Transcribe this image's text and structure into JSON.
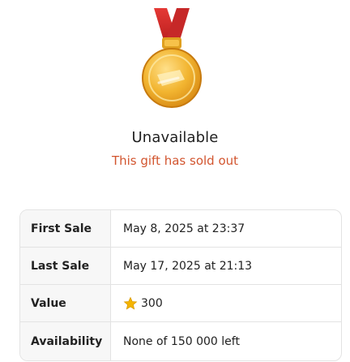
{
  "header": {
    "title": "Unavailable",
    "subtitle": "This gift has sold out"
  },
  "icons": {
    "medal": "medal-icon",
    "star": "star-icon"
  },
  "colors": {
    "subtitle": "#d2552f",
    "ribbon": "#d32f2f",
    "medal_gold": "#f2b531",
    "star_gold": "#f4b400"
  },
  "details": {
    "first_sale_label": "First Sale",
    "first_sale_value": "May 8, 2025 at 23:37",
    "last_sale_label": "Last Sale",
    "last_sale_value": "May 17, 2025 at 21:13",
    "value_label": "Value",
    "value_amount": "300",
    "availability_label": "Availability",
    "availability_value": "None of 150 000 left"
  }
}
